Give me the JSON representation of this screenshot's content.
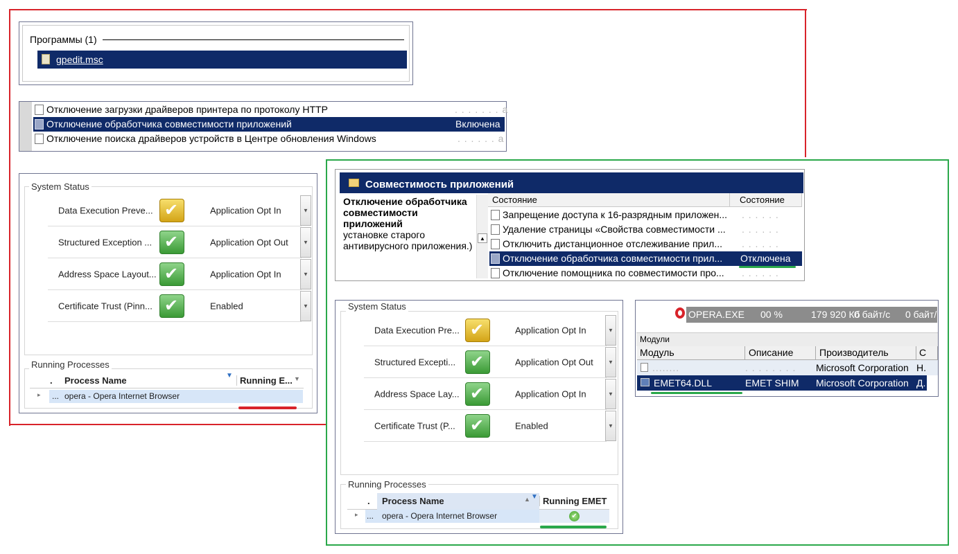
{
  "search_panel": {
    "group_title": "Программы (1)",
    "result": "gpedit.msc"
  },
  "policy_list": {
    "rows": [
      {
        "name": "Отключение загрузки драйверов принтера по протоколу HTTP",
        "state": ". . . . . . . a"
      },
      {
        "name": "Отключение обработчика совместимости приложений",
        "state": "Включена"
      },
      {
        "name": "Отключение поиска драйверов устройств в Центре обновления Windows",
        "state": ". . . . . . a"
      }
    ]
  },
  "emet_left": {
    "system_status_label": "System Status",
    "rows": [
      {
        "name": "Data Execution Preve...",
        "value": "Application Opt In",
        "status": "yellow"
      },
      {
        "name": "Structured Exception ...",
        "value": "Application Opt Out",
        "status": "green"
      },
      {
        "name": "Address Space Layout...",
        "value": "Application Opt In",
        "status": "green"
      },
      {
        "name": "Certificate Trust (Pinn...",
        "value": "Enabled",
        "status": "green"
      }
    ],
    "running_label": "Running Processes",
    "col_dot": ".",
    "col_process": "Process Name",
    "col_running": "Running E...",
    "process_dots": "...",
    "process": "opera - Opera Internet Browser",
    "running_value": ""
  },
  "compat_window": {
    "title": "Совместимость приложений",
    "desc_bold": "Отключение обработчика совместимости приложений",
    "desc_text": "установке старого антивирусного приложения.)",
    "col_name": "Состояние",
    "col_state": "Состояние",
    "rows": [
      {
        "name": "Запрещение доступа к 16-разрядным приложен...",
        "state": ". . . . . ."
      },
      {
        "name": "Удаление страницы «Свойства совместимости ...",
        "state": ". . . . . ."
      },
      {
        "name": "Отключить дистанционное отслеживание прил...",
        "state": ". . . . . ."
      },
      {
        "name": "Отключение обработчика совместимости прил...",
        "state": "Отключена"
      },
      {
        "name": "Отключение помощника по совместимости про...",
        "state": ". . . . . ."
      }
    ]
  },
  "emet_right": {
    "system_status_label": "System Status",
    "rows": [
      {
        "name": "Data Execution Pre...",
        "value": "Application Opt In",
        "status": "yellow"
      },
      {
        "name": "Structured Excepti...",
        "value": "Application Opt Out",
        "status": "green"
      },
      {
        "name": "Address Space Lay...",
        "value": "Application Opt In",
        "status": "green"
      },
      {
        "name": "Certificate Trust (P...",
        "value": "Enabled",
        "status": "green"
      }
    ],
    "running_label": "Running Processes",
    "col_dot": ".",
    "col_process": "Process Name",
    "col_running": "Running EMET",
    "process_dots": "...",
    "process": "opera - Opera Internet Browser"
  },
  "process_explorer": {
    "process": "OPERA.EXE",
    "cpu": "00 %",
    "mem": "179 920 Кб",
    "io1": "0 байт/с",
    "io2": "0 байт/",
    "modules_label": "Модули",
    "col_module": "Модуль",
    "col_desc": "Описание",
    "col_vendor": "Производитель",
    "col_extra": "С",
    "rows": [
      {
        "module": "........",
        "desc": ". . . . . . . .",
        "vendor": "Microsoft Corporation",
        "extra": "Н."
      },
      {
        "module": "EMET64.DLL",
        "desc": "EMET SHIM",
        "vendor": "Microsoft Corporation",
        "extra": "Д."
      }
    ]
  }
}
